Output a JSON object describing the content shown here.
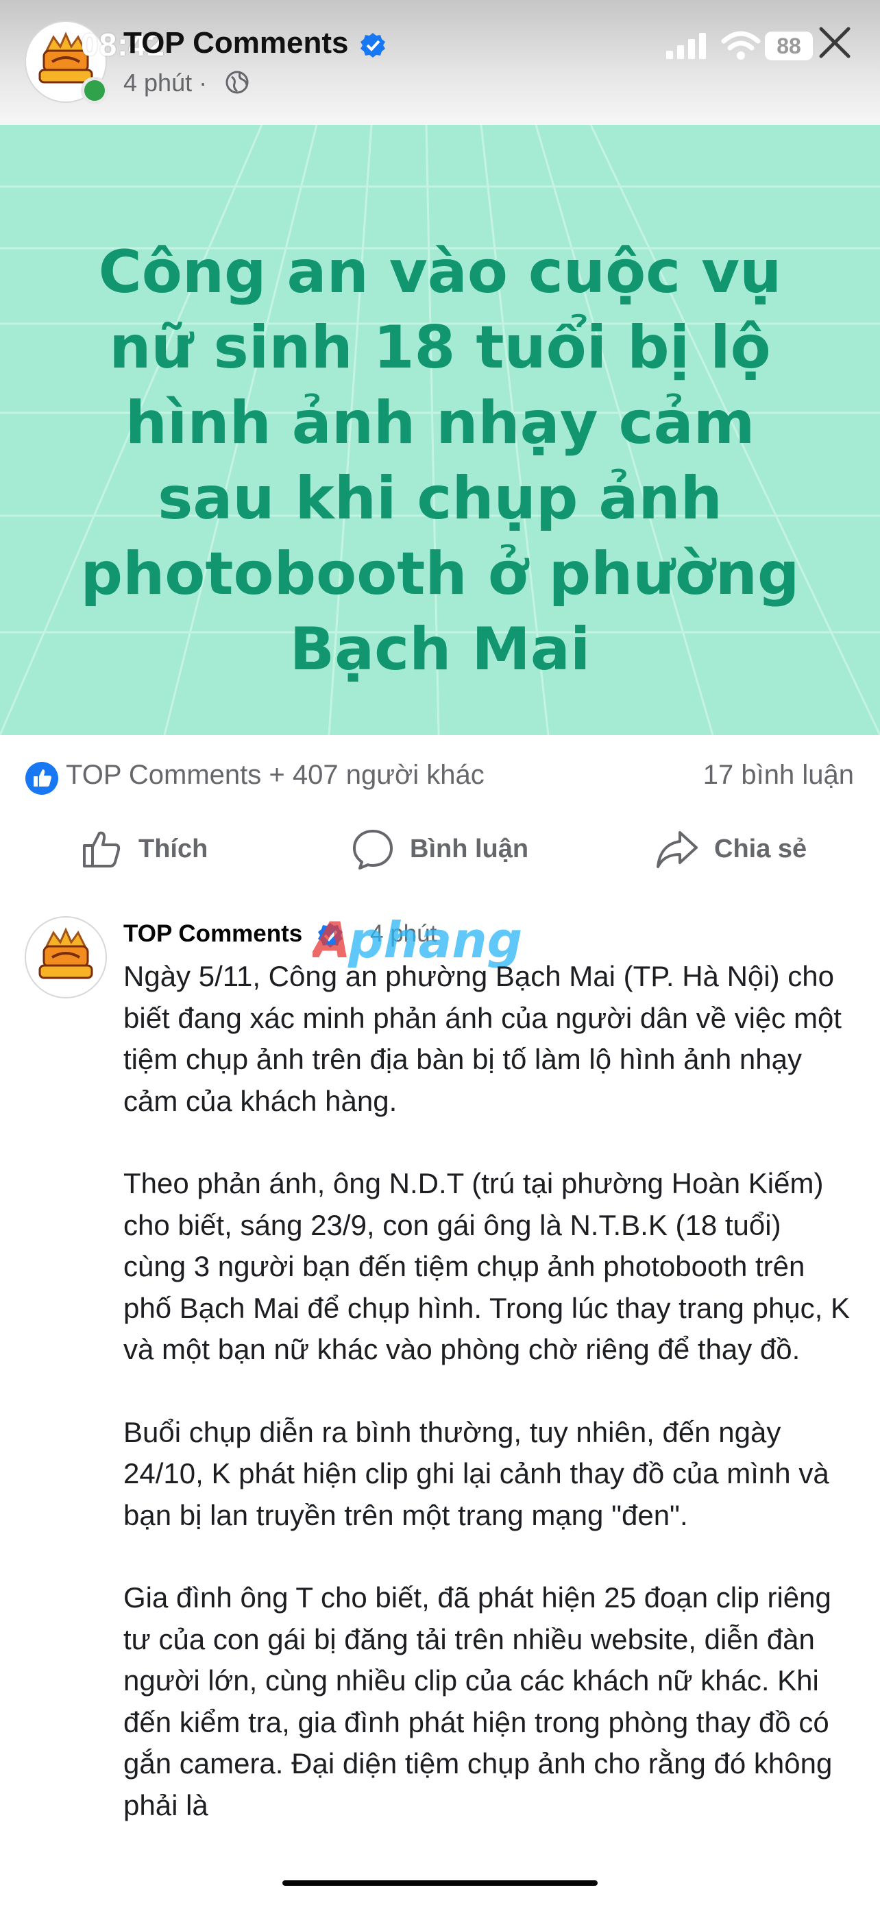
{
  "status_bar": {
    "time": "08:42",
    "battery": "88"
  },
  "post_header": {
    "page_name": "TOP Comments",
    "time": "4 phút",
    "separator": "·"
  },
  "banner": {
    "headline": "Công an vào cuộc vụ nữ sinh 18 tuổi bị lộ hình ảnh nhạy cảm sau khi chụp ảnh photobooth ở phường Bạch Mai"
  },
  "reactions": {
    "text": "TOP Comments + 407 người khác",
    "comment_count": "17 bình luận"
  },
  "actions": {
    "like": "Thích",
    "comment": "Bình luận",
    "share": "Chia sẻ"
  },
  "comment": {
    "author": "TOP Comments",
    "time": "4 phút",
    "watermark": "Aphang",
    "paragraphs": [
      "Ngày 5/11, Công an phường Bạch Mai (TP. Hà Nội) cho biết đang xác minh phản ánh của người dân về việc một tiệm chụp ảnh trên địa bàn bị tố làm lộ hình ảnh nhạy cảm của khách hàng.",
      "Theo phản ánh, ông N.D.T (trú tại phường Hoàn Kiếm) cho biết, sáng 23/9, con gái ông là N.T.B.K (18 tuổi) cùng 3 người bạn đến tiệm chụp ảnh photobooth trên phố Bạch Mai để chụp hình. Trong lúc thay trang phục, K và một bạn nữ khác vào phòng chờ riêng để thay đồ.",
      "Buổi chụp diễn ra bình thường, tuy nhiên, đến ngày 24/10, K phát hiện clip ghi lại cảnh thay đồ của mình và bạn bị lan truyền trên một trang mạng \"đen\".",
      "Gia đình ông T cho biết, đã phát hiện 25 đoạn clip riêng tư của con gái bị đăng tải trên nhiều website, diễn đàn người lớn, cùng nhiều clip của các khách nữ khác. Khi đến kiểm tra, gia đình phát hiện trong phòng thay đồ có gắn camera. Đại diện tiệm chụp ảnh cho rằng đó không phải là"
    ]
  },
  "colors": {
    "banner_bg": "#a5ebd4",
    "headline": "#12966f",
    "verified_blue": "#1877f2",
    "secondary_text": "#65676b",
    "online_green": "#31a24c"
  }
}
